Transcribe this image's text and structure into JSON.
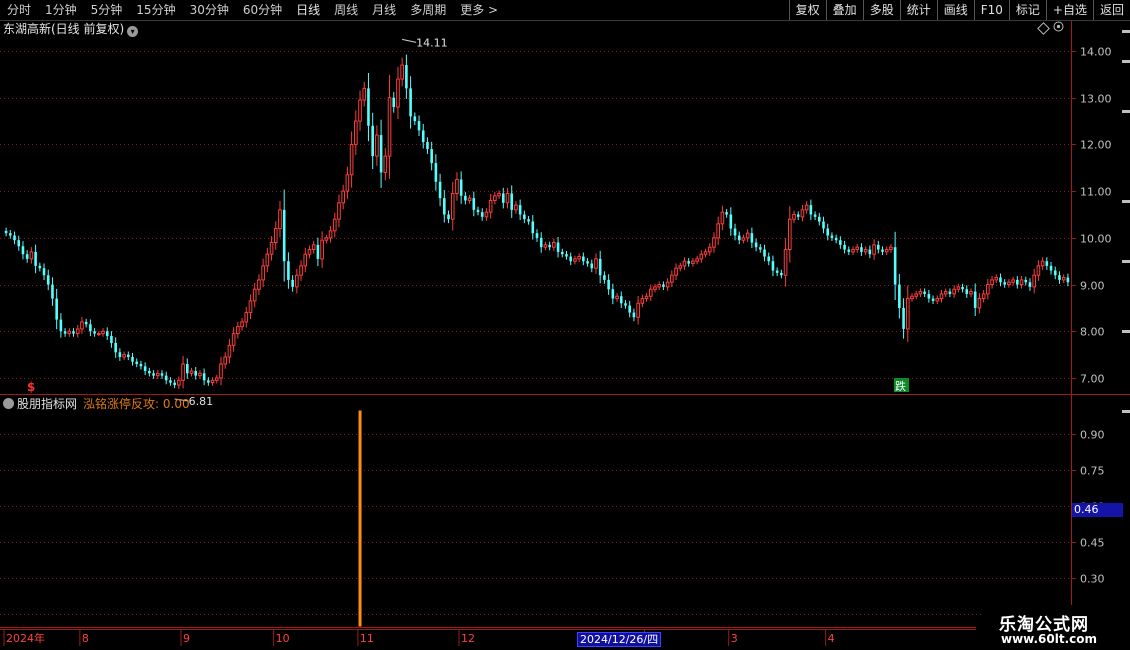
{
  "toolbar": {
    "periods": [
      "分时",
      "1分钟",
      "5分钟",
      "15分钟",
      "30分钟",
      "60分钟",
      "日线",
      "周线",
      "月线",
      "多周期",
      "更多 >"
    ],
    "active": "日线",
    "buttons": [
      "复权",
      "叠加",
      "多股",
      "统计",
      "画线",
      "F10",
      "标记",
      "+自选",
      "返回"
    ]
  },
  "main": {
    "title": "东湖高新(日线 前复权)",
    "max_label": "14.11",
    "min_label": "6.81",
    "sell_marker": "$",
    "fall_marker": "跌"
  },
  "indicator": {
    "source": "股朋指标网",
    "line_label": "泓铭涨停反攻: 0.00",
    "current_value": "0.46"
  },
  "time_axis": {
    "labels": [
      {
        "text": "2024年",
        "i": 0
      },
      {
        "text": "8",
        "i": 18
      },
      {
        "text": "9",
        "i": 42
      },
      {
        "text": "10",
        "i": 64
      },
      {
        "text": "11",
        "i": 84
      },
      {
        "text": "12",
        "i": 108
      },
      {
        "text": "2",
        "i": 152
      },
      {
        "text": "3",
        "i": 172
      },
      {
        "text": "4",
        "i": 195
      }
    ],
    "cursor_date": "2024/12/26/四"
  },
  "watermark": {
    "brand": "乐淘公式网",
    "url": "www.60lt.com"
  },
  "colors": {
    "up": "#ff3c3c",
    "down": "#54ffff",
    "grid": "#8a1a1a",
    "axis": "#a01a1a",
    "signal": "#ff8c1a"
  },
  "chart_data": [
    {
      "type": "candlestick",
      "ylim": [
        6.7,
        14.3
      ],
      "yticks": [
        7.0,
        8.0,
        9.0,
        10.0,
        11.0,
        12.0,
        13.0,
        14.0
      ],
      "close": [
        10.1,
        10.05,
        9.95,
        9.82,
        9.65,
        9.55,
        9.7,
        9.4,
        9.35,
        9.2,
        9.0,
        8.7,
        8.25,
        8.0,
        7.95,
        8.0,
        7.95,
        8.05,
        8.2,
        8.15,
        8.0,
        7.95,
        7.95,
        8.0,
        7.9,
        7.75,
        7.55,
        7.45,
        7.5,
        7.45,
        7.35,
        7.3,
        7.25,
        7.15,
        7.1,
        7.05,
        7.1,
        7.05,
        6.95,
        6.9,
        6.85,
        6.95,
        7.3,
        7.1,
        7.15,
        7.05,
        7.1,
        6.95,
        6.9,
        6.95,
        7.0,
        7.3,
        7.45,
        7.7,
        7.95,
        8.1,
        8.2,
        8.4,
        8.65,
        8.9,
        9.1,
        9.4,
        9.65,
        9.9,
        10.2,
        10.6,
        9.5,
        9.1,
        8.95,
        9.2,
        9.4,
        9.65,
        9.75,
        9.85,
        9.55,
        9.95,
        10.0,
        10.15,
        10.4,
        10.75,
        11.0,
        11.35,
        12.0,
        12.5,
        12.95,
        13.2,
        12.4,
        11.75,
        12.2,
        11.4,
        11.75,
        13.0,
        12.8,
        13.4,
        13.7,
        13.2,
        12.6,
        12.5,
        12.3,
        12.05,
        11.9,
        11.6,
        11.2,
        10.85,
        10.5,
        10.4,
        10.95,
        11.25,
        10.9,
        10.8,
        10.85,
        10.6,
        10.55,
        10.45,
        10.55,
        10.8,
        10.9,
        10.95,
        10.75,
        10.95,
        10.6,
        10.7,
        10.5,
        10.4,
        10.35,
        10.1,
        10.0,
        9.8,
        9.85,
        9.8,
        9.9,
        9.7,
        9.65,
        9.6,
        9.5,
        9.55,
        9.6,
        9.5,
        9.45,
        9.35,
        9.55,
        9.2,
        9.1,
        8.9,
        8.7,
        8.75,
        8.6,
        8.55,
        8.4,
        8.3,
        8.6,
        8.7,
        8.75,
        8.9,
        8.95,
        9.0,
        8.95,
        9.05,
        9.2,
        9.35,
        9.4,
        9.5,
        9.45,
        9.5,
        9.55,
        9.65,
        9.7,
        9.8,
        10.0,
        10.3,
        10.55,
        10.5,
        10.2,
        10.05,
        9.95,
        10.0,
        10.1,
        9.9,
        9.8,
        9.75,
        9.6,
        9.5,
        9.3,
        9.25,
        9.2,
        9.75,
        10.4,
        10.5,
        10.45,
        10.6,
        10.7,
        10.5,
        10.45,
        10.35,
        10.2,
        10.05,
        10.0,
        9.95,
        9.85,
        9.75,
        9.7,
        9.75,
        9.8,
        9.7,
        9.75,
        9.65,
        9.85,
        9.75,
        9.7,
        9.75,
        9.8,
        9.0,
        8.5,
        8.05,
        8.7,
        8.75,
        8.8,
        8.85,
        8.8,
        8.7,
        8.65,
        8.7,
        8.8,
        8.85,
        8.8,
        8.9,
        8.95,
        8.9,
        8.8,
        8.85,
        8.5,
        8.7,
        8.8,
        9.0,
        9.1,
        9.15,
        9.05,
        9.0,
        9.05,
        9.1,
        9.0,
        9.1,
        9.05,
        8.95,
        9.2,
        9.4,
        9.5,
        9.4,
        9.3,
        9.2,
        9.1,
        9.15,
        9.05
      ],
      "signal": {
        "index": 84,
        "value": 1.0
      },
      "indicator_ylim": [
        0.1,
        1.0
      ],
      "indicator_yticks": [
        0.15,
        0.3,
        0.45,
        0.6,
        0.75,
        0.9
      ]
    }
  ]
}
